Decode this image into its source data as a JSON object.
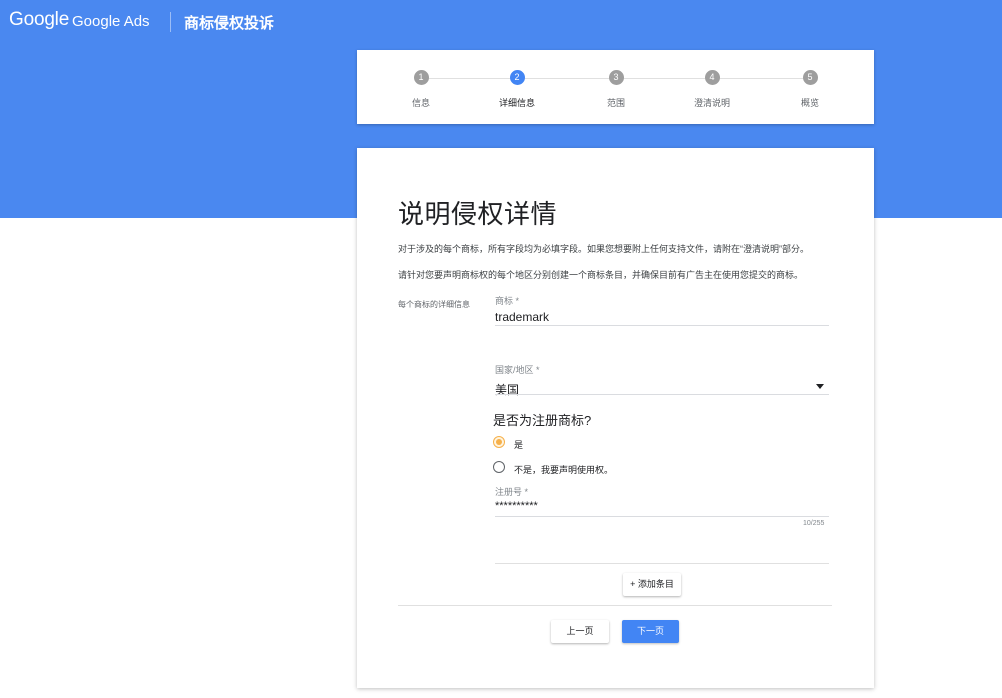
{
  "header": {
    "logo": "Google",
    "product": "Google Ads",
    "title": "商标侵权投诉"
  },
  "stepper": {
    "steps": [
      {
        "number": "1",
        "label": "信息"
      },
      {
        "number": "2",
        "label": "详细信息"
      },
      {
        "number": "3",
        "label": "范围"
      },
      {
        "number": "4",
        "label": "澄清说明"
      },
      {
        "number": "5",
        "label": "概览"
      }
    ],
    "active_index": 1
  },
  "form": {
    "title": "说明侵权详情",
    "description_1": "对于涉及的每个商标，所有字段均为必填字段。如果您想要附上任何支持文件，请附在“澄清说明”部分。",
    "description_2": "请针对您要声明商标权的每个地区分别创建一个商标条目，并确保目前有广告主在使用您提交的商标。",
    "side_label": "每个商标的详细信息",
    "trademark": {
      "label": "商标 *",
      "value": "trademark"
    },
    "country": {
      "label": "国家/地区 *",
      "value": "美国"
    },
    "registered_question": "是否为注册商标?",
    "radio_yes": "是",
    "radio_no": "不是，我要声明使用权。",
    "registration": {
      "label": "注册号 *",
      "value": "**********",
      "counter": "10/255"
    },
    "add_entry": "+ 添加条目",
    "prev_button": "上一页",
    "next_button": "下一页"
  },
  "colors": {
    "brand_blue": "#4a88f0",
    "accent": "#4285f4",
    "radio_selected": "#f6b04a"
  }
}
